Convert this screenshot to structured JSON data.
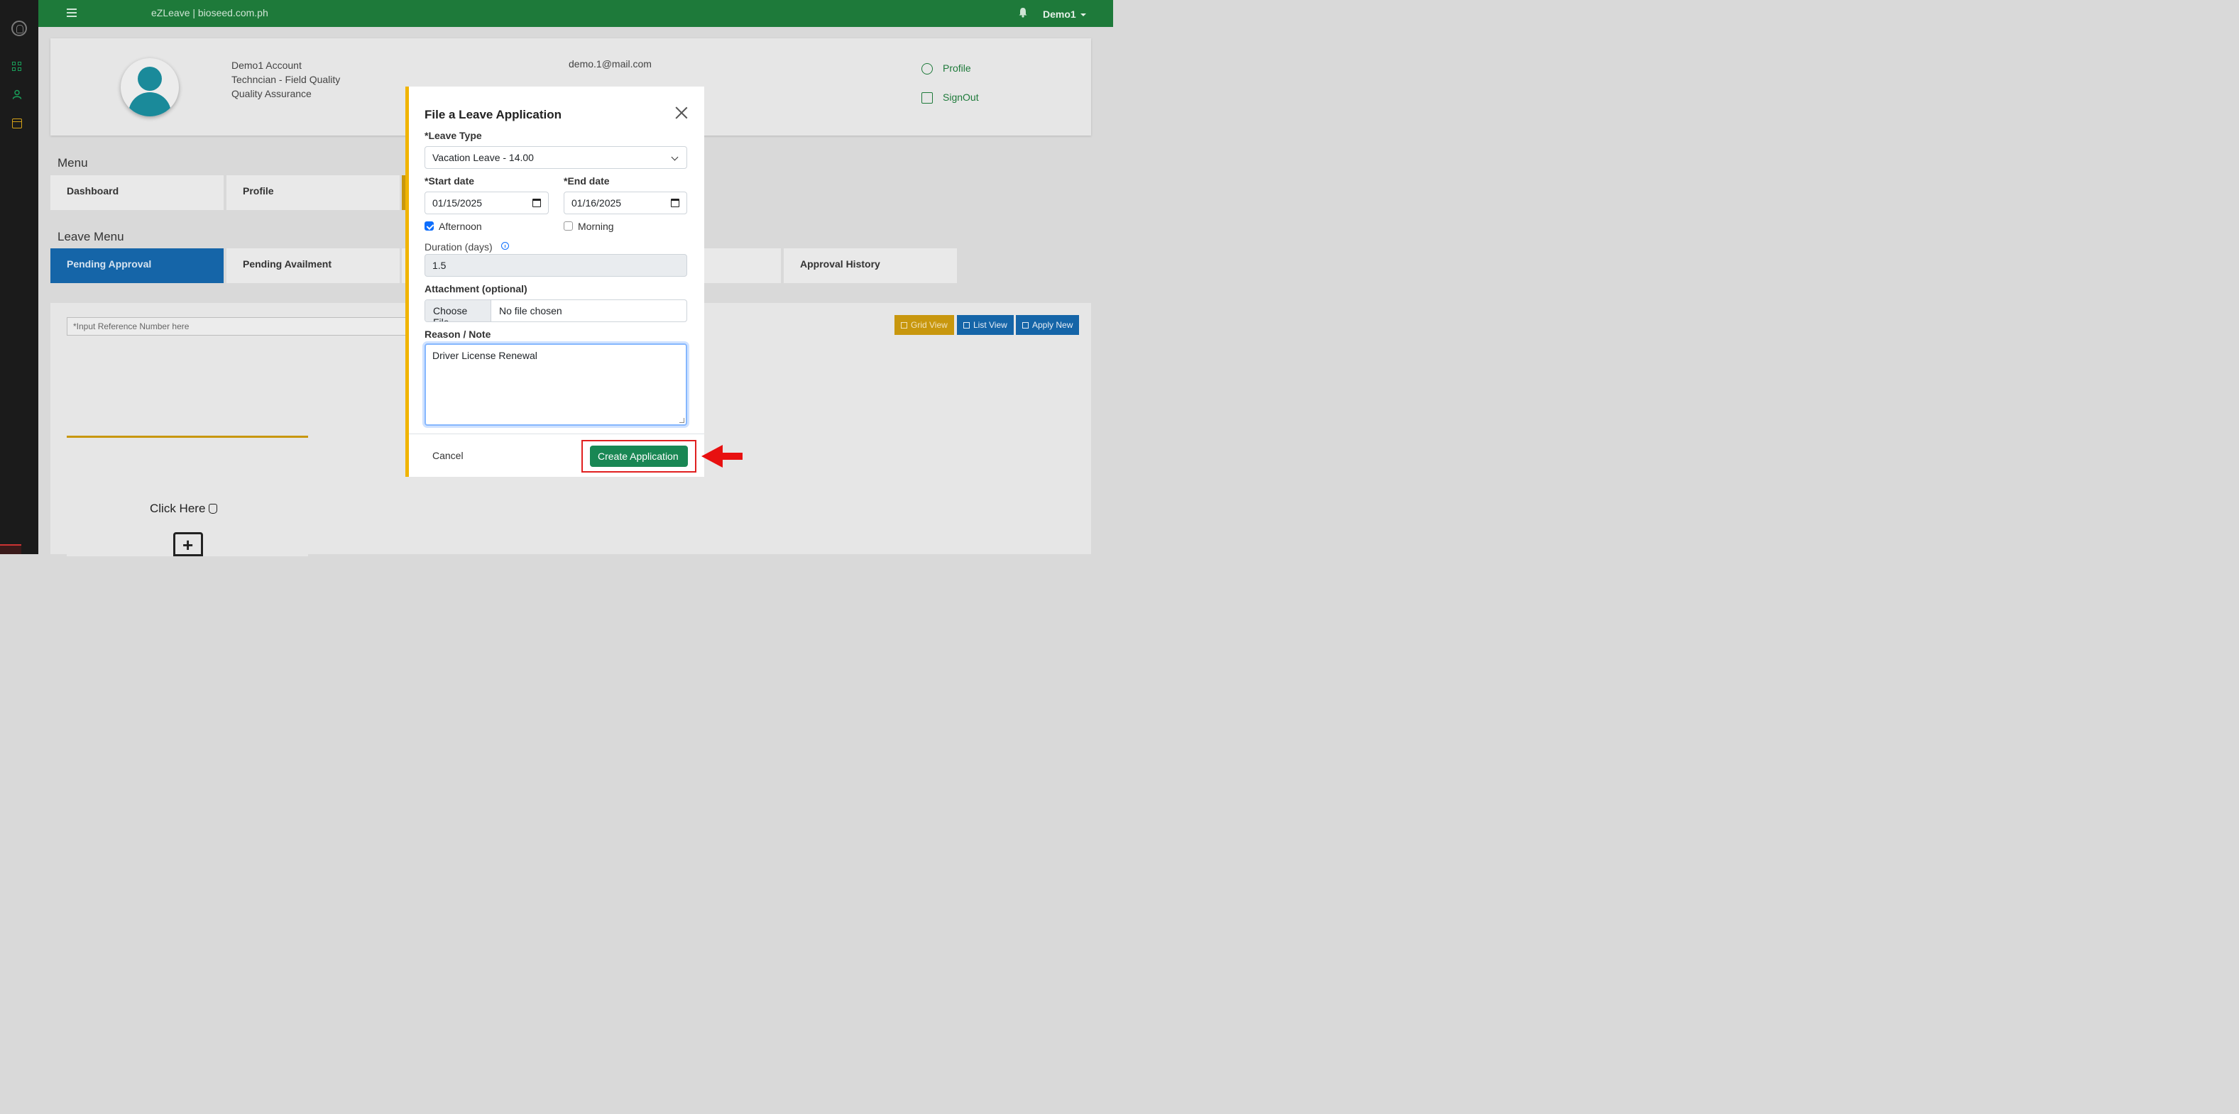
{
  "topbar": {
    "brand": "eZLeave | bioseed.com.ph",
    "user": "Demo1"
  },
  "profile": {
    "name": "Demo1 Account",
    "position": "Techncian - Field Quality",
    "department": "Quality Assurance",
    "email": "demo.1@mail.com",
    "links": {
      "profile": "Profile",
      "signout": "SignOut"
    }
  },
  "menu": {
    "title": "Menu",
    "items": [
      "Dashboard",
      "Profile"
    ]
  },
  "leave_menu": {
    "title": "Leave Menu",
    "tabs": [
      "Pending Approval",
      "Pending Availment",
      "Approval History"
    ]
  },
  "list": {
    "search_placeholder": "*Input Reference Number here",
    "buttons": {
      "grid": "Grid View",
      "list": "List View",
      "apply": "Apply New"
    },
    "click_card": {
      "label": "Click Here"
    }
  },
  "colors": {
    "topbar": "#1e7a3a",
    "accent": "#f0b400",
    "primary": "#1565a8",
    "success": "#198754",
    "highlight": "#e02020"
  },
  "modal": {
    "title": "File a Leave Application",
    "leave_type_label": "*Leave Type",
    "leave_type_value": "Vacation Leave - 14.00",
    "start_label": "*Start date",
    "start_value": "01/15/2025",
    "end_label": "*End date",
    "end_value": "01/16/2025",
    "afternoon_label": "Afternoon",
    "afternoon_checked": true,
    "morning_label": "Morning",
    "morning_checked": false,
    "duration_label": "Duration (days)",
    "duration_value": "1.5",
    "attachment_label": "Attachment (optional)",
    "choose_file_label": "Choose File",
    "file_status": "No file chosen",
    "reason_label": "Reason / Note",
    "reason_value": "Driver License Renewal",
    "cancel_label": "Cancel",
    "create_label": "Create Application"
  }
}
